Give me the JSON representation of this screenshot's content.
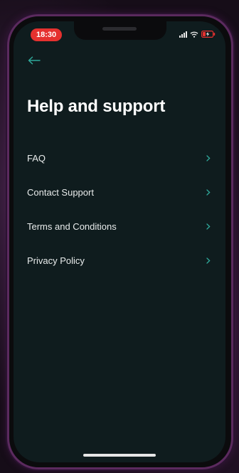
{
  "status_bar": {
    "time": "18:30",
    "icons": [
      "signal-icon",
      "wifi-icon",
      "battery-charging-icon"
    ]
  },
  "header": {
    "back_icon": "arrow-left-icon",
    "title": "Help and support"
  },
  "menu": {
    "items": [
      {
        "label": "FAQ",
        "icon": "chevron-right-icon"
      },
      {
        "label": "Contact Support",
        "icon": "chevron-right-icon"
      },
      {
        "label": "Terms and Conditions",
        "icon": "chevron-right-icon"
      },
      {
        "label": "Privacy Policy",
        "icon": "chevron-right-icon"
      }
    ]
  },
  "colors": {
    "screen_background": "#0f1c1e",
    "accent": "#2fa89a",
    "time_pill": "#e5312f",
    "text_primary": "#ffffff",
    "phone_border": "#5b2a5e"
  }
}
